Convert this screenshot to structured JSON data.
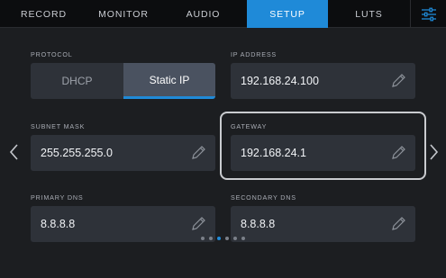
{
  "tabs": [
    {
      "label": "RECORD",
      "active": false
    },
    {
      "label": "MONITOR",
      "active": false
    },
    {
      "label": "AUDIO",
      "active": false
    },
    {
      "label": "SETUP",
      "active": true
    },
    {
      "label": "LUTS",
      "active": false
    }
  ],
  "menu_icon": "sliders-icon",
  "protocol": {
    "label": "PROTOCOL",
    "options": [
      "DHCP",
      "Static IP"
    ],
    "selected": "Static IP"
  },
  "ip_address": {
    "label": "IP ADDRESS",
    "value": "192.168.24.100"
  },
  "subnet_mask": {
    "label": "SUBNET MASK",
    "value": "255.255.255.0"
  },
  "gateway": {
    "label": "GATEWAY",
    "value": "192.168.24.1",
    "focused": true
  },
  "primary_dns": {
    "label": "PRIMARY DNS",
    "value": "8.8.8.8"
  },
  "secondary_dns": {
    "label": "SECONDARY DNS",
    "value": "8.8.8.8"
  },
  "pagination": {
    "pages": 6,
    "current": 3
  },
  "colors": {
    "accent": "#1f8ad8",
    "background": "#1c1e21",
    "tabbar": "#0c0d0f",
    "field": "#2e3239"
  }
}
